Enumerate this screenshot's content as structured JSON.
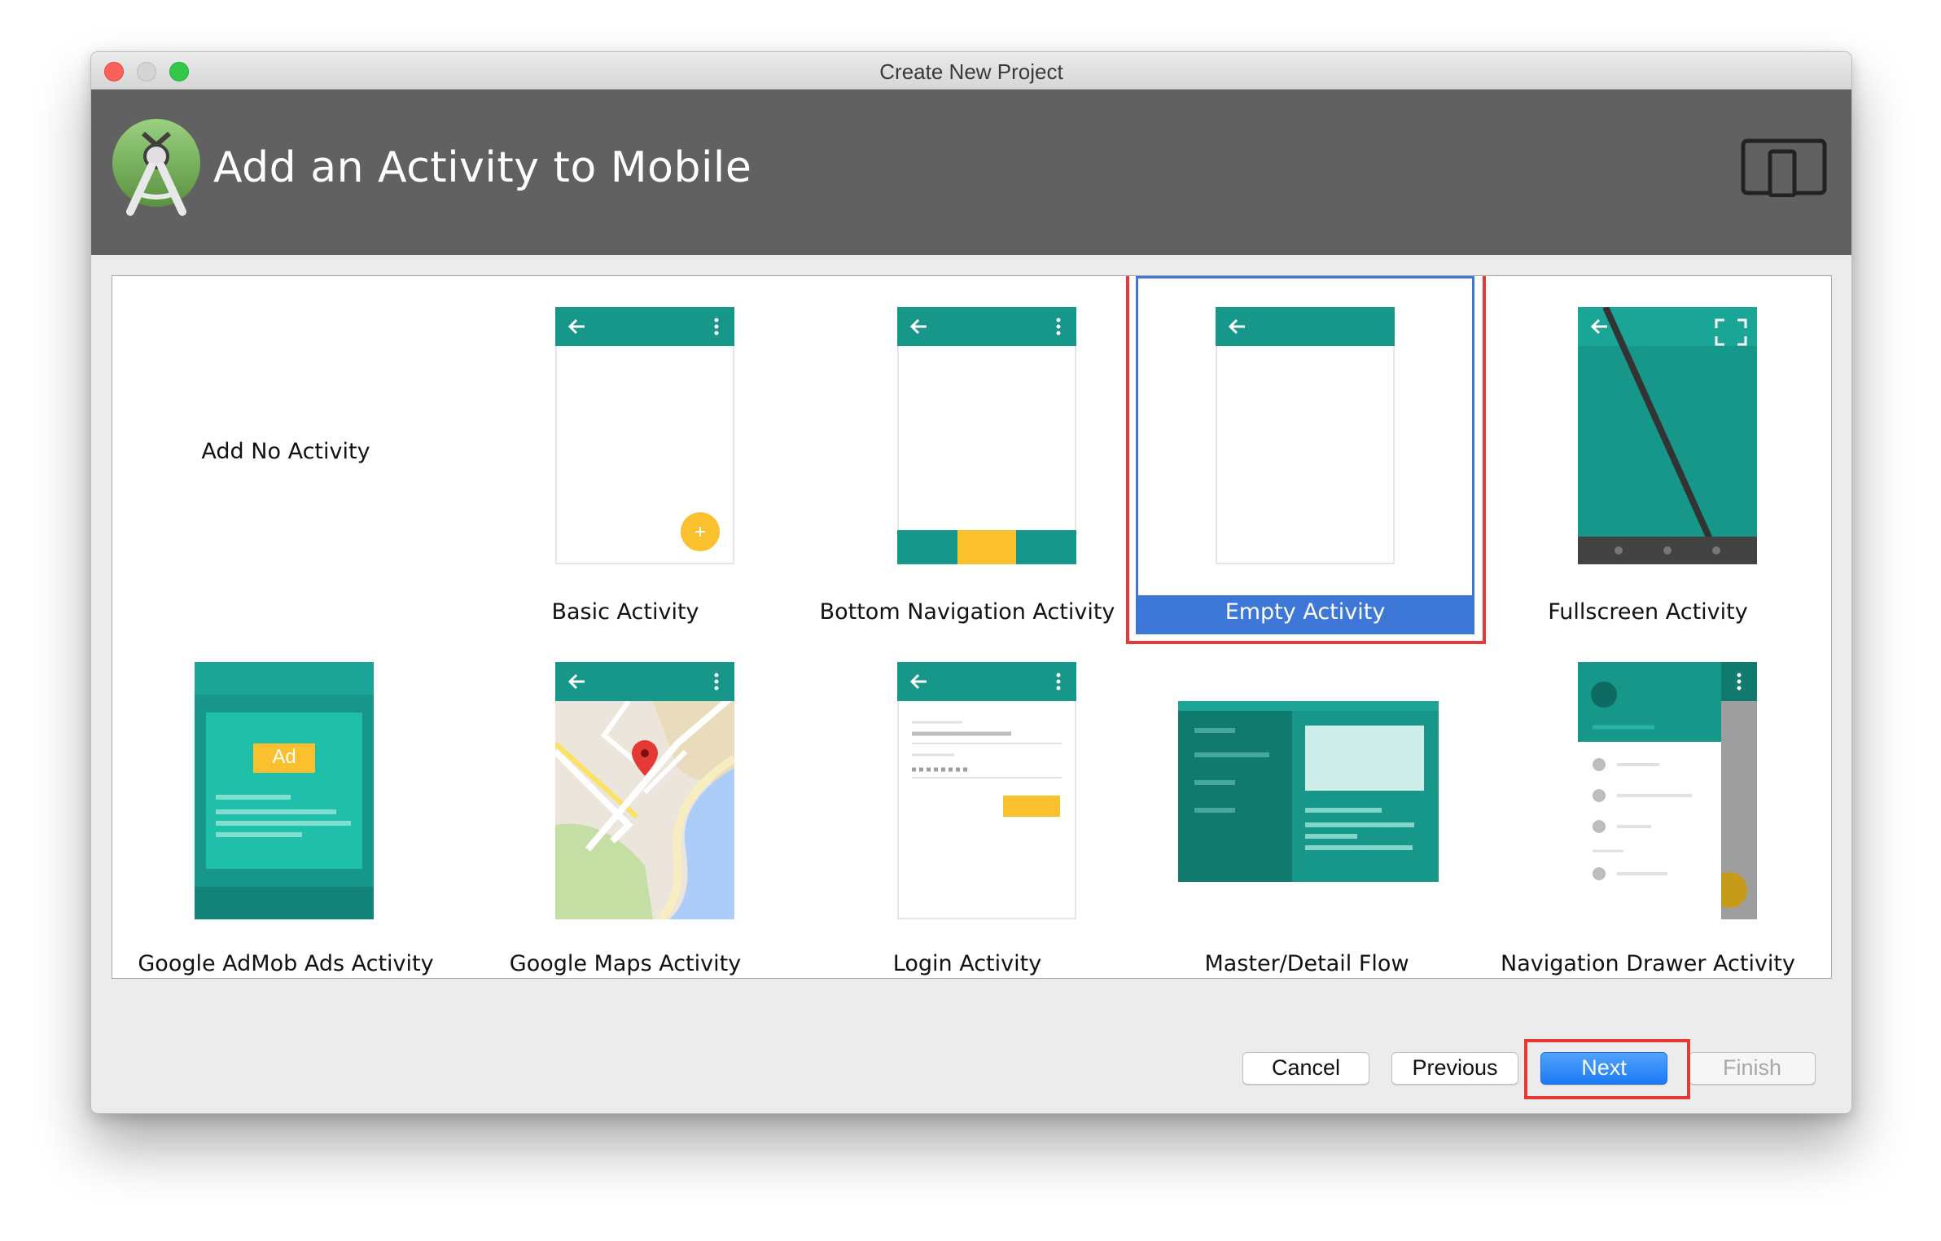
{
  "window": {
    "title": "Create New Project"
  },
  "header": {
    "title": "Add an Activity to Mobile"
  },
  "icons": {
    "logo": "android-studio-logo-icon",
    "form_factor": "phone-tablet-device-icon"
  },
  "activities": [
    {
      "label": "Add No Activity",
      "selected": false
    },
    {
      "label": "Basic Activity",
      "selected": false
    },
    {
      "label": "Bottom Navigation Activity",
      "selected": false
    },
    {
      "label": "Empty Activity",
      "selected": true
    },
    {
      "label": "Fullscreen Activity",
      "selected": false
    },
    {
      "label": "Google AdMob Ads Activity",
      "selected": false
    },
    {
      "label": "Google Maps Activity",
      "selected": false
    },
    {
      "label": "Login Activity",
      "selected": false
    },
    {
      "label": "Master/Detail Flow",
      "selected": false
    },
    {
      "label": "Navigation Drawer Activity",
      "selected": false
    }
  ],
  "ad_badge": "Ad",
  "buttons": {
    "cancel": "Cancel",
    "previous": "Previous",
    "next": "Next",
    "finish": "Finish"
  },
  "colors": {
    "teal": "#16978a",
    "teal_dark": "#117a6f",
    "accent": "#fbc02d",
    "selection": "#3d78d8",
    "highlight": "#e53935"
  }
}
